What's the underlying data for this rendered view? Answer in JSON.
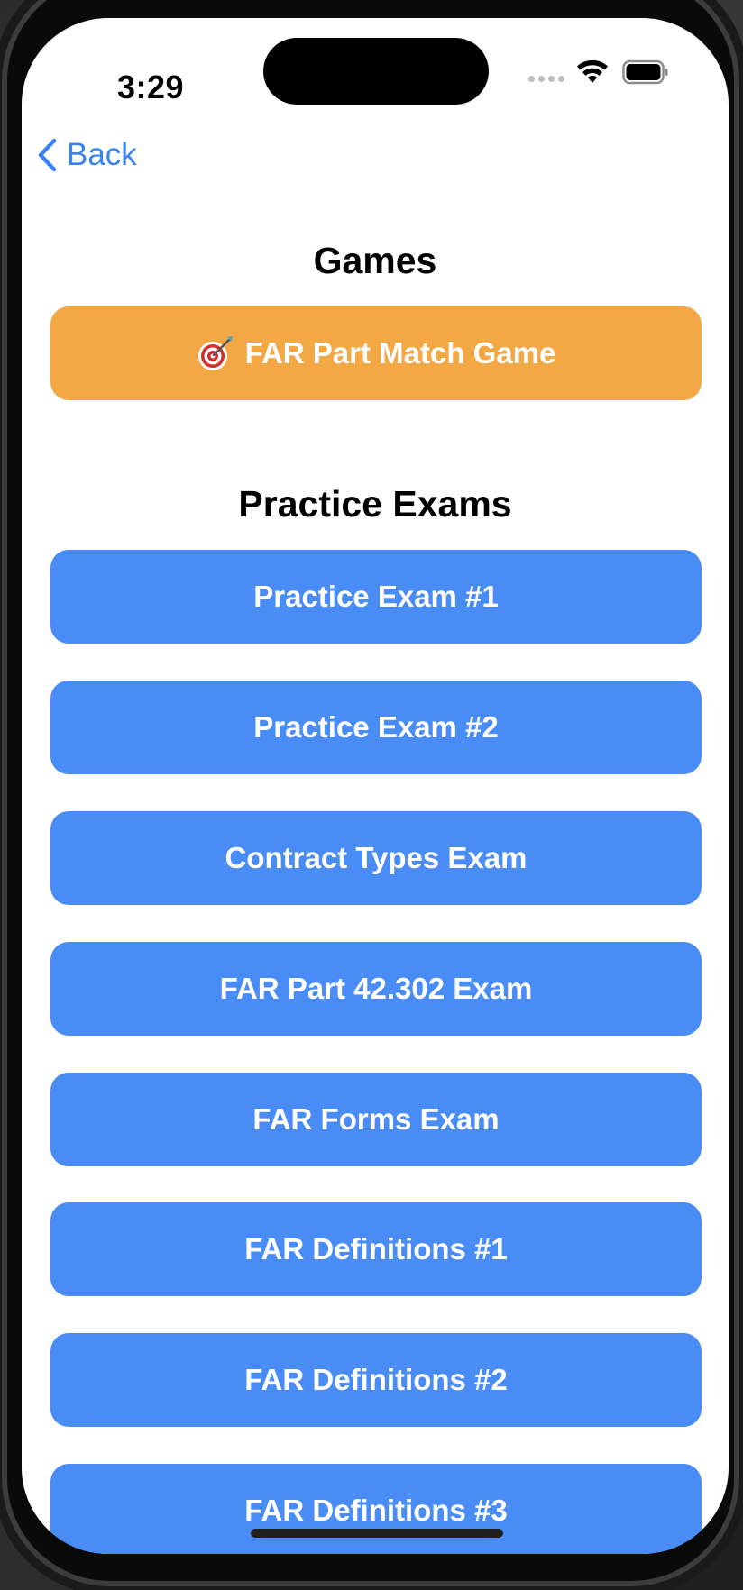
{
  "status_bar": {
    "time": "3:29"
  },
  "nav": {
    "back_label": "Back"
  },
  "games": {
    "title": "Games",
    "items": [
      {
        "label": "FAR Part Match Game",
        "icon": "target-icon"
      }
    ]
  },
  "practice_exams": {
    "title": "Practice Exams",
    "items": [
      {
        "label": "Practice Exam #1"
      },
      {
        "label": "Practice Exam #2"
      },
      {
        "label": "Contract Types Exam"
      },
      {
        "label": "FAR Part 42.302 Exam"
      },
      {
        "label": "FAR Forms Exam"
      },
      {
        "label": "FAR Definitions #1"
      },
      {
        "label": "FAR Definitions #2"
      },
      {
        "label": "FAR Definitions #3"
      }
    ]
  },
  "colors": {
    "accent": "#3b82f6",
    "game_button": "#f3a846",
    "exam_button": "#4a8cf6"
  }
}
